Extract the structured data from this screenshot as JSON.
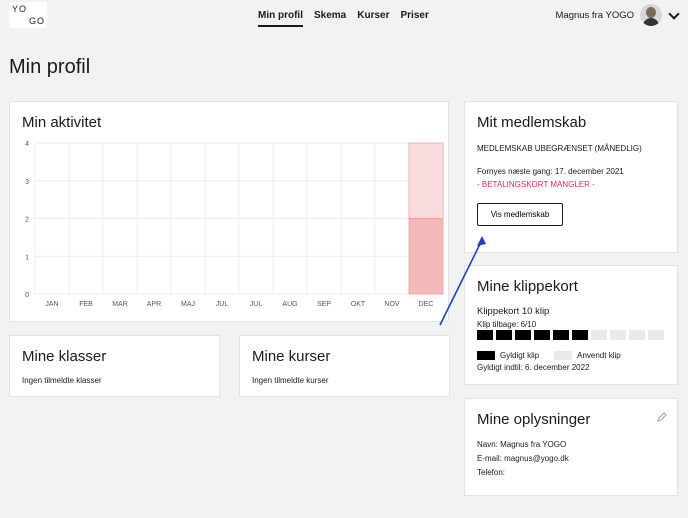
{
  "logo": {
    "line1": "YO",
    "line2": "GO"
  },
  "nav": [
    {
      "label": "Min profil",
      "active": true
    },
    {
      "label": "Skema",
      "active": false
    },
    {
      "label": "Kurser",
      "active": false
    },
    {
      "label": "Priser",
      "active": false
    }
  ],
  "user": {
    "name": "Magnus fra YOGO",
    "icon": "chevron-down-icon"
  },
  "page_title": "Min profil",
  "activity": {
    "title": "Min aktivitet",
    "chart_data": {
      "type": "bar",
      "categories": [
        "JAN",
        "FEB",
        "MAR",
        "APR",
        "MAJ",
        "JUL",
        "JUL",
        "AUG",
        "SEP",
        "OKT",
        "NOV",
        "DEC"
      ],
      "values": [
        0,
        0,
        0,
        0,
        0,
        0,
        0,
        0,
        0,
        0,
        0,
        2
      ],
      "planned": [
        0,
        0,
        0,
        0,
        0,
        0,
        0,
        0,
        0,
        0,
        0,
        2
      ],
      "ylim": [
        0,
        4
      ],
      "yticks": [
        0,
        1,
        2,
        3,
        4
      ],
      "grid": true,
      "colors": {
        "bar": "#f4b9b9",
        "bar_border": "#f08d8d",
        "planned": "#fbe3e3"
      }
    }
  },
  "membership": {
    "title": "Mit medlemskab",
    "plan": "MEDLEMSKAB UBEGRÆNSET (MÅNEDLIG)",
    "renews": "Fornyes næste gang: 17. december 2021",
    "warning": "- BETALINGSKORT MANGLER -",
    "button": "Vis medlemskab",
    "warning_color": "#e0245e"
  },
  "clips": {
    "title": "Mine klippekort",
    "card_name": "Klippekort 10 klip",
    "remaining": "Klip tilbage: 6/10",
    "total": 10,
    "used": 6,
    "legend_used": "Gyldigt klip",
    "legend_spent": "Anvendt klip",
    "valid_until": "Gyldigt indtil: 6. december 2022"
  },
  "info": {
    "title": "Mine oplysninger",
    "name": "Navn: Magnus fra YOGO",
    "email": "E-mail: magnus@yogo.dk",
    "phone": "Telefon:",
    "edit_icon": "pencil-icon"
  },
  "classes": {
    "title": "Mine klasser",
    "empty": "Ingen tilmeldte klasser"
  },
  "courses": {
    "title": "Mine kurser",
    "empty": "Ingen tilmeldte kurser"
  },
  "annotation": {
    "color": "#1f3fbf"
  }
}
